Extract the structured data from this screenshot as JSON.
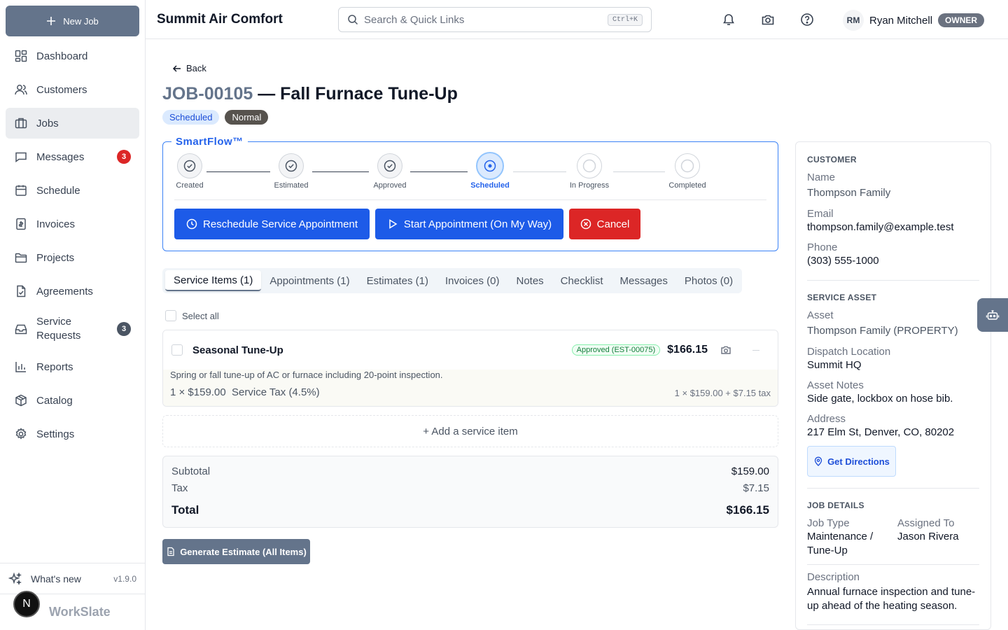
{
  "sidebar": {
    "new_job_label": "New Job",
    "items": [
      {
        "label": "Dashboard",
        "icon": "dashboard-icon"
      },
      {
        "label": "Customers",
        "icon": "users-icon"
      },
      {
        "label": "Jobs",
        "icon": "briefcase-icon",
        "active": true
      },
      {
        "label": "Messages",
        "icon": "message-icon",
        "badge": "3"
      },
      {
        "label": "Schedule",
        "icon": "calendar-icon"
      },
      {
        "label": "Invoices",
        "icon": "invoice-icon"
      },
      {
        "label": "Projects",
        "icon": "folder-icon"
      },
      {
        "label": "Agreements",
        "icon": "file-check-icon"
      },
      {
        "label": "Service Requests",
        "icon": "inbox-icon",
        "badge": "3"
      },
      {
        "label": "Reports",
        "icon": "bar-chart-icon"
      },
      {
        "label": "Catalog",
        "icon": "package-icon"
      },
      {
        "label": "Settings",
        "icon": "gear-icon"
      }
    ],
    "whats_new": "What's new",
    "version": "v1.9.0",
    "brand": "WorkSlate",
    "n_button": "N"
  },
  "topbar": {
    "company": "Summit Air Comfort",
    "search_placeholder": "Search & Quick Links",
    "search_shortcut": "Ctrl+K",
    "user_initials": "RM",
    "user_name": "Ryan Mitchell",
    "user_role": "OWNER"
  },
  "job": {
    "back_label": "Back",
    "id": "JOB-00105",
    "title": " — Fall Furnace Tune-Up",
    "status": "Scheduled",
    "priority": "Normal"
  },
  "smartflow": {
    "label": "SmartFlow™",
    "steps": [
      {
        "label": "Created",
        "state": "done"
      },
      {
        "label": "Estimated",
        "state": "done"
      },
      {
        "label": "Approved",
        "state": "done"
      },
      {
        "label": "Scheduled",
        "state": "current"
      },
      {
        "label": "In Progress",
        "state": "todo"
      },
      {
        "label": "Completed",
        "state": "todo"
      }
    ],
    "buttons": {
      "reschedule": "Reschedule Service Appointment",
      "start": "Start Appointment (On My Way)",
      "cancel": "Cancel"
    }
  },
  "tabs": [
    "Service Items (1)",
    "Appointments (1)",
    "Estimates (1)",
    "Invoices (0)",
    "Notes",
    "Checklist",
    "Messages",
    "Photos (0)"
  ],
  "service_items": {
    "select_all": "Select all",
    "items": [
      {
        "name": "Seasonal Tune-Up",
        "approval": "Approved (EST-00075)",
        "price": "$166.15",
        "description": "Spring or fall tune-up of AC or furnace including 20-point inspection.",
        "qty_line": "1 × $159.00",
        "tax_line": "Service Tax (4.5%)",
        "calc": "1 × $159.00 + $7.15 tax"
      }
    ],
    "add_label": "+ Add a service item"
  },
  "totals": {
    "subtotal_label": "Subtotal",
    "subtotal": "$159.00",
    "tax_label": "Tax",
    "tax": "$7.15",
    "total_label": "Total",
    "total": "$166.15"
  },
  "generate_estimate_label": "Generate Estimate (All Items)",
  "customer": {
    "section": "CUSTOMER",
    "name_label": "Name",
    "name": "Thompson Family",
    "email_label": "Email",
    "email": "thompson.family@example.test",
    "phone_label": "Phone",
    "phone": "(303) 555-1000"
  },
  "asset": {
    "section": "SERVICE ASSET",
    "asset_label": "Asset",
    "asset": "Thompson Family (PROPERTY)",
    "dispatch_label": "Dispatch Location",
    "dispatch": "Summit HQ",
    "notes_label": "Asset Notes",
    "notes": "Side gate, lockbox on hose bib.",
    "address_label": "Address",
    "address": "217 Elm St, Denver, CO, 80202",
    "directions_label": "Get Directions"
  },
  "job_details": {
    "section": "JOB DETAILS",
    "type_label": "Job Type",
    "type_line1": "Maintenance /",
    "type_line2": "Tune-Up",
    "assigned_label": "Assigned To",
    "assigned": "Jason Rivera",
    "desc_label": "Description",
    "desc_line1": "Annual furnace inspection and tune-",
    "desc_line2": "up ahead of the heating season."
  },
  "colors": {
    "accent": "#1d5be8",
    "danger": "#dc2626",
    "slate": "#64748b"
  }
}
